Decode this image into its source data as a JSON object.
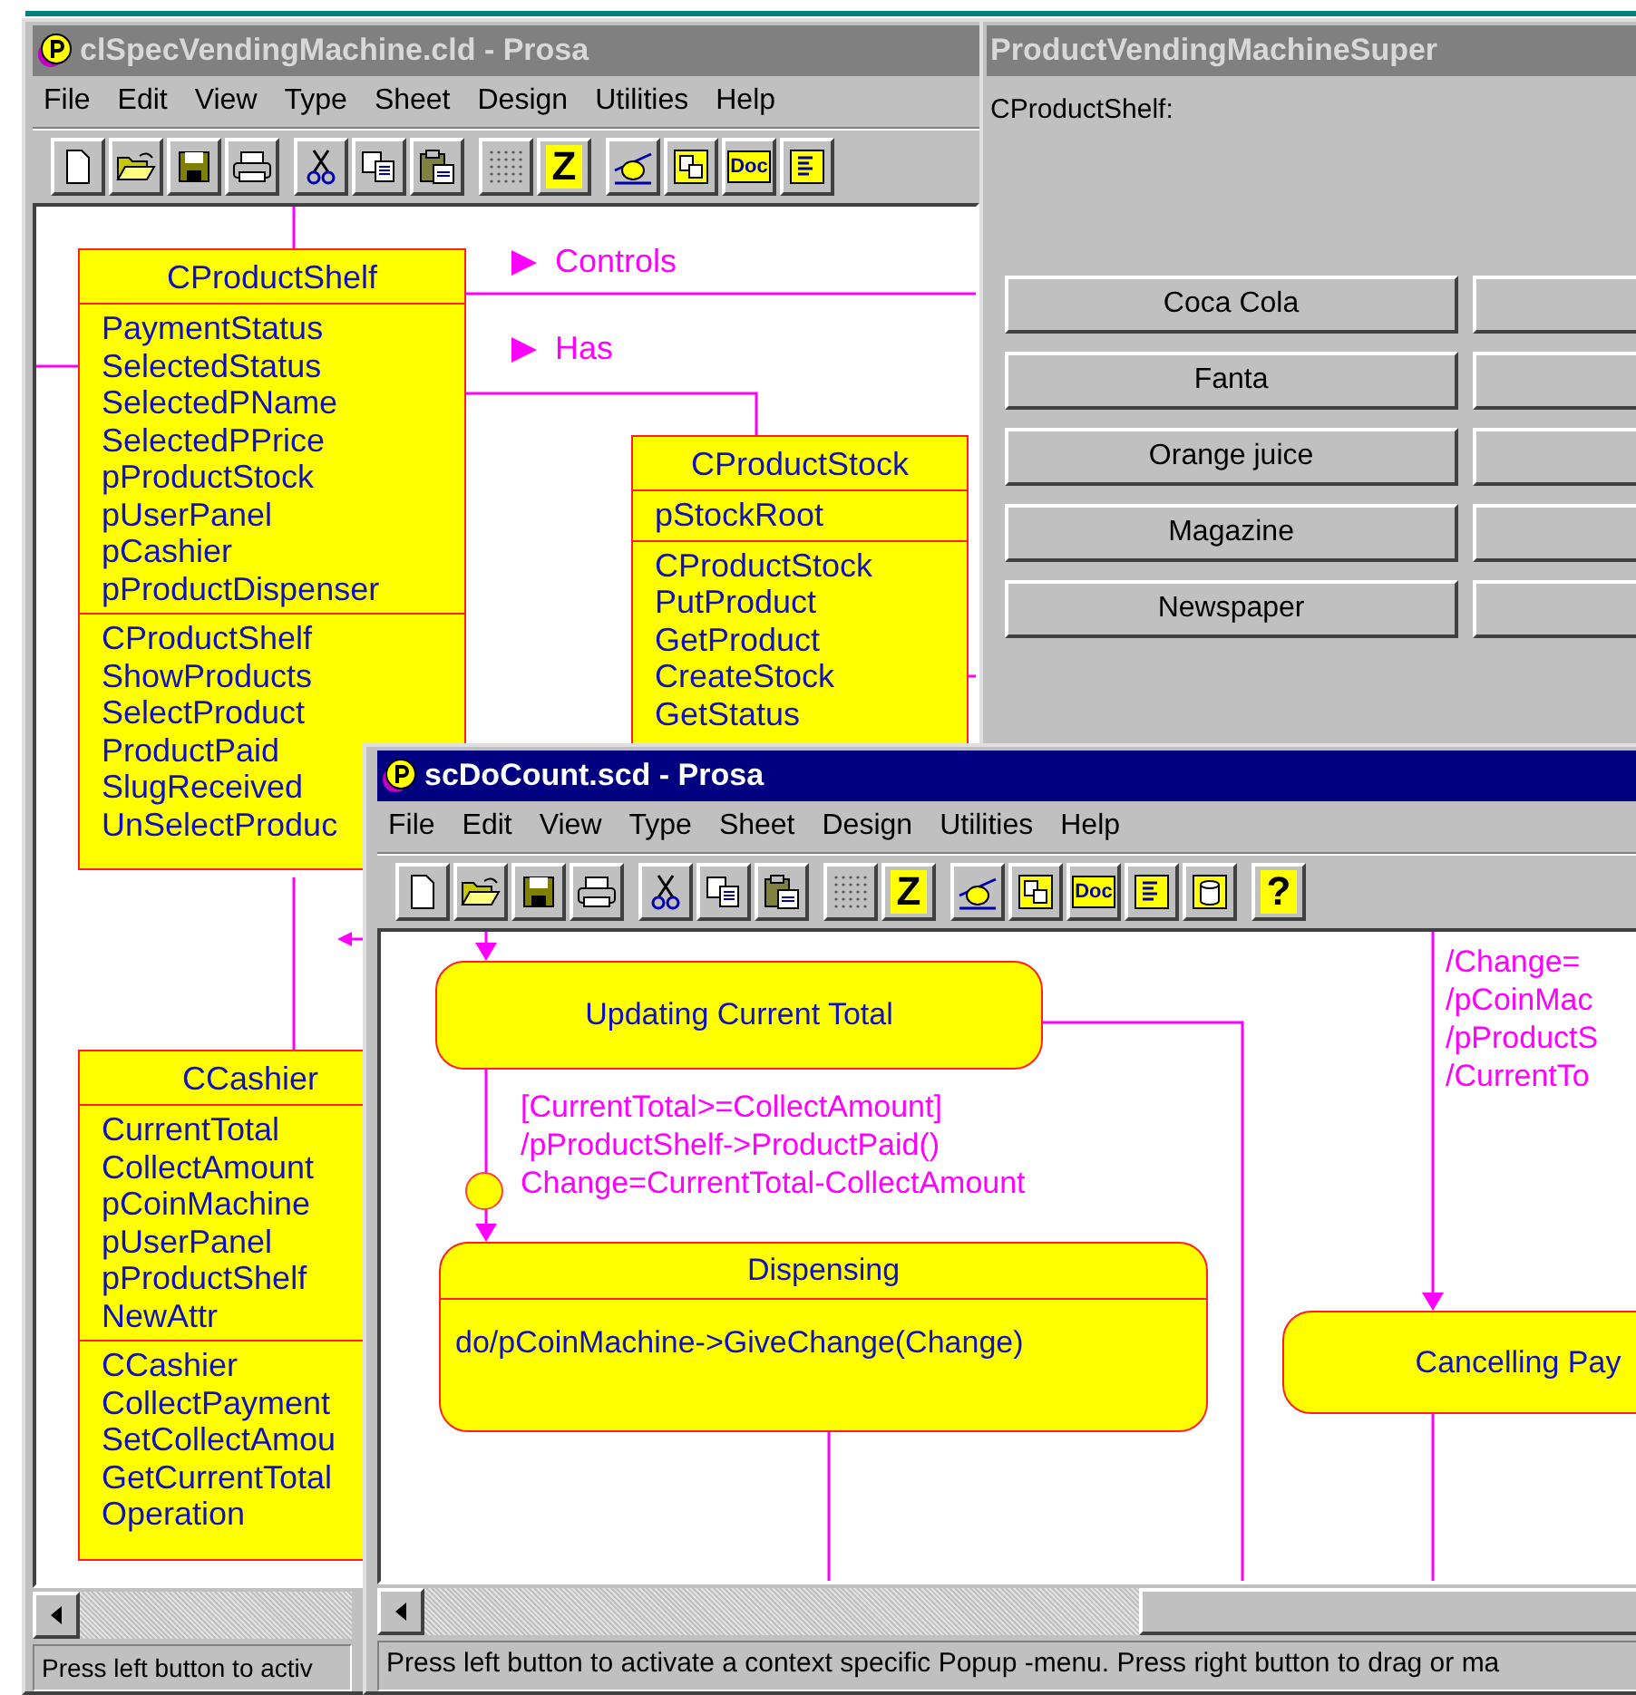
{
  "class_window": {
    "title": "clSpecVendingMachine.cld - Prosa",
    "active": false,
    "menu": [
      "File",
      "Edit",
      "View",
      "Type",
      "Sheet",
      "Design",
      "Utilities",
      "Help"
    ],
    "toolbar": [
      [
        {
          "kind": "new"
        },
        {
          "kind": "open"
        },
        {
          "kind": "save"
        },
        {
          "kind": "print"
        }
      ],
      [
        {
          "kind": "cut"
        },
        {
          "kind": "copy"
        },
        {
          "kind": "paste"
        }
      ],
      [
        {
          "kind": "grid"
        },
        {
          "kind": "letter",
          "label": "Z"
        }
      ],
      [
        {
          "kind": "state"
        },
        {
          "kind": "class"
        },
        {
          "kind": "doc",
          "label": "Doc"
        },
        {
          "kind": "list"
        }
      ]
    ],
    "classes": [
      {
        "name": "CProductShelf",
        "attributes": [
          "PaymentStatus",
          "SelectedStatus",
          "SelectedPName",
          "SelectedPPrice",
          "pProductStock",
          "pUserPanel",
          "pCashier",
          "pProductDispenser"
        ],
        "operations": [
          "CProductShelf",
          "ShowProducts",
          "SelectProduct",
          "ProductPaid",
          "SlugReceived",
          "UnSelectProduc"
        ]
      },
      {
        "name": "CProductStock",
        "attributes": [
          "pStockRoot"
        ],
        "operations": [
          "CProductStock",
          "PutProduct",
          "GetProduct",
          "CreateStock",
          "GetStatus"
        ]
      },
      {
        "name": "CCashier",
        "attributes": [
          "CurrentTotal",
          "CollectAmount",
          "pCoinMachine",
          "pUserPanel",
          "pProductShelf",
          "NewAttr"
        ],
        "operations": [
          "CCashier",
          "CollectPayment",
          "SetCollectAmou",
          "GetCurrentTotal",
          "Operation"
        ]
      }
    ],
    "associations": [
      {
        "label": "Controls"
      },
      {
        "label": "Has"
      }
    ],
    "status_bar": "Press left button to activ"
  },
  "form_window": {
    "title": "ProductVendingMachineSuper",
    "active": false,
    "label": "CProductShelf:",
    "buttons": [
      {
        "label": "Coca Cola"
      },
      {
        "label": "Fanta"
      },
      {
        "label": "Orange juice"
      },
      {
        "label": "Magazine"
      },
      {
        "label": "Newspaper"
      }
    ]
  },
  "state_window": {
    "title": "scDoCount.scd - Prosa",
    "active": true,
    "menu": [
      "File",
      "Edit",
      "View",
      "Type",
      "Sheet",
      "Design",
      "Utilities",
      "Help"
    ],
    "toolbar": [
      [
        {
          "kind": "new"
        },
        {
          "kind": "open"
        },
        {
          "kind": "save"
        },
        {
          "kind": "print"
        }
      ],
      [
        {
          "kind": "cut"
        },
        {
          "kind": "copy"
        },
        {
          "kind": "paste"
        }
      ],
      [
        {
          "kind": "grid"
        },
        {
          "kind": "letter",
          "label": "Z"
        }
      ],
      [
        {
          "kind": "state"
        },
        {
          "kind": "class"
        },
        {
          "kind": "doc",
          "label": "Doc"
        },
        {
          "kind": "list"
        },
        {
          "kind": "db"
        }
      ],
      [
        {
          "kind": "letter",
          "label": "?"
        }
      ]
    ],
    "states": [
      {
        "name": "Updating Current Total"
      },
      {
        "name": "Dispensing",
        "activity": "do/pCoinMachine->GiveChange(Change)"
      },
      {
        "name": "Cancelling Pay"
      }
    ],
    "transitions": [
      {
        "lines": [
          "[CurrentTotal>=CollectAmount]",
          "/pProductShelf->ProductPaid()",
          "Change=CurrentTotal-CollectAmount"
        ]
      },
      {
        "lines": [
          "/Change=",
          "/pCoinMac",
          "/pProductS",
          "/CurrentTo"
        ]
      }
    ],
    "status_bar": "Press left button to activate a context specific Popup -menu. Press right button to drag or ma"
  }
}
